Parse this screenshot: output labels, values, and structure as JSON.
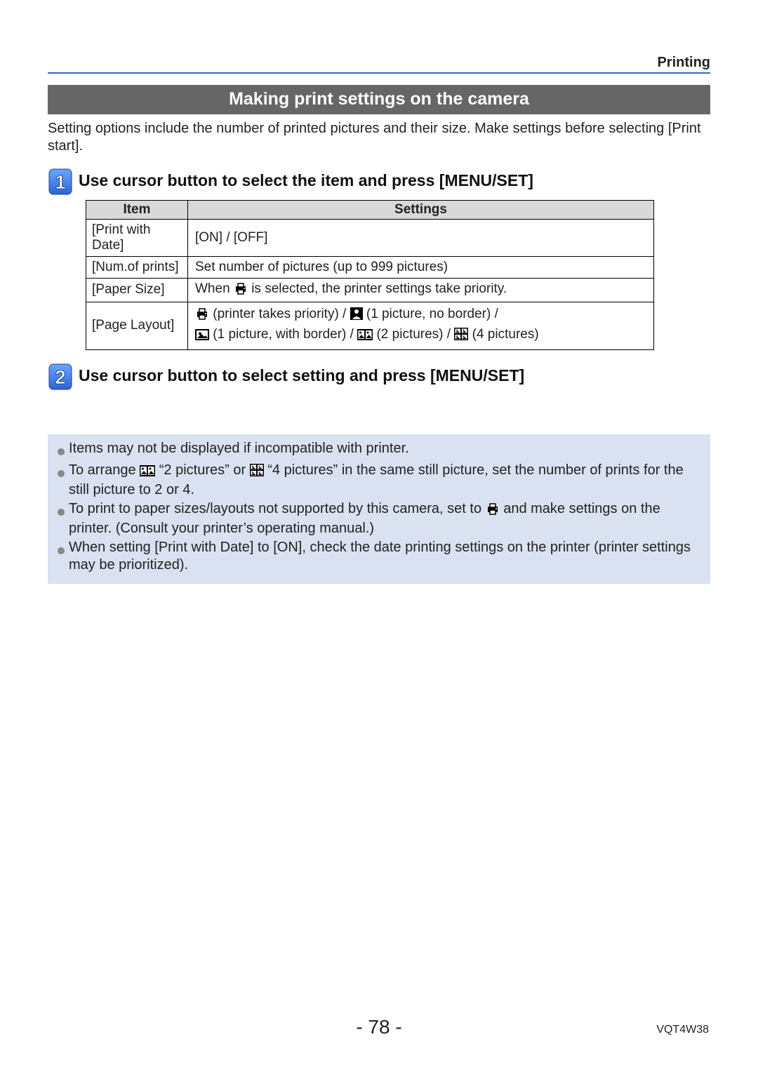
{
  "header": {
    "section": "Printing"
  },
  "title_bar": "Making print settings on the camera",
  "intro": "Setting options include the number of printed pictures and their size. Make settings before selecting [Print start].",
  "step1": {
    "number": "1",
    "title": "Use cursor button to select the item and press [MENU/SET]",
    "table": {
      "head_item": "Item",
      "head_settings": "Settings",
      "rows": [
        {
          "item": "[Print with Date]",
          "settings_plain": "[ON] / [OFF]"
        },
        {
          "item": "[Num.of prints]",
          "settings_plain": "Set number of pictures (up to 999 pictures)"
        },
        {
          "item": "[Paper Size]",
          "settings_pre": "When ",
          "settings_post": " is selected, the printer settings take priority."
        },
        {
          "item": "[Page Layout]",
          "l1_a": " (printer takes priority) / ",
          "l1_b": " (1 picture, no border) / ",
          "l2_a": " (1 picture, with border) / ",
          "l2_b": " (2 pictures) / ",
          "l2_c": " (4 pictures)"
        }
      ]
    }
  },
  "step2": {
    "number": "2",
    "title": "Use cursor button to select setting and press [MENU/SET]"
  },
  "notes": {
    "n1": "Items may not be displayed if incompatible with printer.",
    "n2_a": "To arrange ",
    "n2_b": " “2 pictures” or ",
    "n2_c": " “4 pictures” in the same still picture, set the number of prints for the still picture to 2 or 4.",
    "n3_a": "To print to paper sizes/layouts not supported by this camera, set to ",
    "n3_b": " and make settings on the printer. (Consult your printer’s operating manual.)",
    "n4": "When setting [Print with Date] to [ON], check the date printing settings on the printer (printer settings may be prioritized)."
  },
  "footer": {
    "page": "- 78 -",
    "code": "VQT4W38"
  }
}
